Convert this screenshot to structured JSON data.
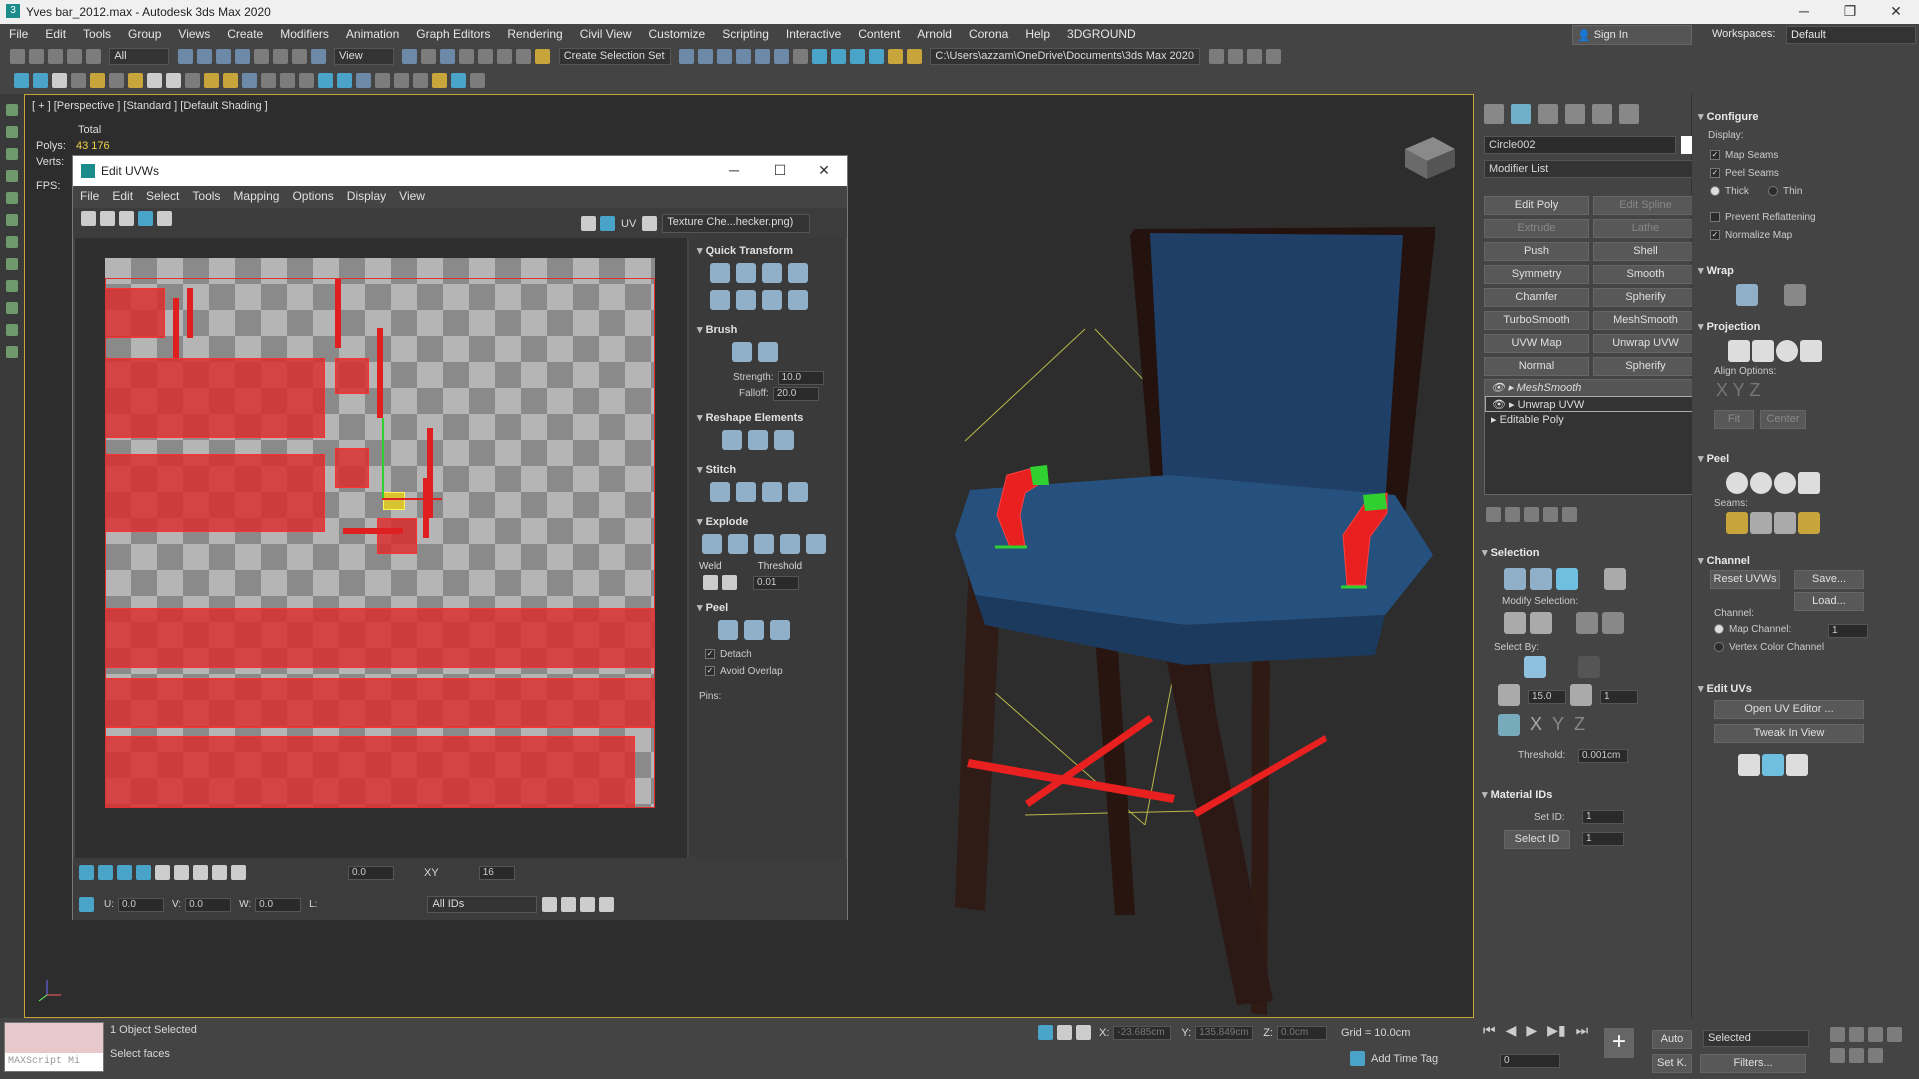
{
  "window": {
    "title": "Yves bar_2012.max - Autodesk 3ds Max 2020"
  },
  "menu": [
    "File",
    "Edit",
    "Tools",
    "Group",
    "Views",
    "Create",
    "Modifiers",
    "Animation",
    "Graph Editors",
    "Rendering",
    "Civil View",
    "Customize",
    "Scripting",
    "Interactive",
    "Content",
    "Arnold",
    "Corona",
    "Help",
    "3DGROUND"
  ],
  "toolbar": {
    "filter": "All",
    "ref_coord": "View",
    "selection_set": "Create Selection Set",
    "path": "C:\\Users\\azzam\\OneDrive\\Documents\\3ds Max 2020",
    "sign_in": "Sign In",
    "workspaces_label": "Workspaces:",
    "workspace": "Default"
  },
  "viewport": {
    "label": "[ + ] [Perspective ] [Standard ] [Default Shading ]",
    "stats_total": "Total",
    "polys_label": "Polys:",
    "polys": "43 176",
    "verts_label": "Verts:",
    "fps_label": "FPS:"
  },
  "uv": {
    "title": "Edit UVWs",
    "menu": [
      "File",
      "Edit",
      "Select",
      "Tools",
      "Mapping",
      "Options",
      "Display",
      "View"
    ],
    "uv_label": "UV",
    "texture": "Texture Che...hecker.png)",
    "sections": {
      "quick": "Quick Transform",
      "brush": "Brush",
      "reshape": "Reshape Elements",
      "stitch": "Stitch",
      "explode": "Explode",
      "peel": "Peel"
    },
    "strength_label": "Strength:",
    "strength": "10.0",
    "falloff_label": "Falloff:",
    "falloff": "20.0",
    "weld_label": "Weld",
    "threshold_label": "Threshold",
    "threshold": "0.01",
    "detach": "Detach",
    "avoid_overlap": "Avoid Overlap",
    "pins": "Pins:",
    "u_label": "U:",
    "u": "0.0",
    "v_label": "V:",
    "v": "0.0",
    "w_label": "W:",
    "w": "0.0",
    "l_label": "L:",
    "angle": "0.0",
    "xy": "XY",
    "grid": "16",
    "ids": "All IDs"
  },
  "cmd": {
    "object_name": "Circle002",
    "modifier_list": "Modifier List",
    "buttons": [
      [
        "Edit Poly",
        "Edit Spline"
      ],
      [
        "Extrude",
        "Lathe"
      ],
      [
        "Push",
        "Shell"
      ],
      [
        "Symmetry",
        "Smooth"
      ],
      [
        "Chamfer",
        "Spherify"
      ],
      [
        "TurboSmooth",
        "MeshSmooth"
      ],
      [
        "UVW Map",
        "Unwrap UVW"
      ],
      [
        "Normal",
        "Spherify"
      ]
    ],
    "stack": [
      "MeshSmooth",
      "Unwrap UVW",
      "Editable Poly"
    ],
    "selection": "Selection",
    "modify_selection": "Modify Selection:",
    "select_by": "Select By:",
    "angle": "15.0",
    "count": "1",
    "threshold_label": "Threshold:",
    "threshold": "0.001cm",
    "material_ids": "Material IDs",
    "set_id_label": "Set ID:",
    "set_id": "1",
    "select_id": "Select ID",
    "select_id_val": "1"
  },
  "cmd2": {
    "configure": "Configure",
    "display": "Display:",
    "map_seams": "Map Seams",
    "peel_seams": "Peel Seams",
    "thick": "Thick",
    "thin": "Thin",
    "prevent": "Prevent Reflattening",
    "normalize": "Normalize Map",
    "wrap": "Wrap",
    "projection": "Projection",
    "align": "Align Options:",
    "fit": "Fit",
    "center": "Center",
    "peel": "Peel",
    "seams": "Seams:",
    "channel": "Channel",
    "reset": "Reset UVWs",
    "save": "Save...",
    "load": "Load...",
    "channel_label": "Channel:",
    "map_channel": "Map Channel:",
    "map_channel_val": "1",
    "vertex_color": "Vertex Color Channel",
    "edit_uvs": "Edit UVs",
    "open_uv": "Open UV Editor ...",
    "tweak": "Tweak In View"
  },
  "status": {
    "objects": "1 Object Selected",
    "prompt": "Select faces",
    "maxscript": "MAXScript Mi",
    "x_label": "X:",
    "x": "-23.685cm",
    "y_label": "Y:",
    "y": "135.849cm",
    "z_label": "Z:",
    "z": "0.0cm",
    "grid": "Grid = 10.0cm",
    "time_tag": "Add Time Tag",
    "auto": "Auto",
    "set_k": "Set K.",
    "selected": "Selected",
    "filters": "Filters...",
    "frame": "0"
  }
}
